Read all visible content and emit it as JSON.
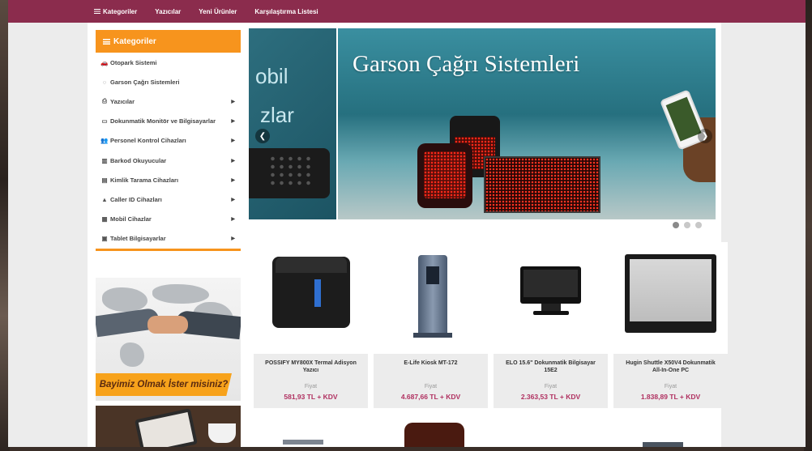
{
  "nav": {
    "items": [
      "Kategoriler",
      "Yazıcılar",
      "Yeni Ürünler",
      "Karşılaştırma Listesi"
    ]
  },
  "sidebar": {
    "title": "Kategoriler",
    "items": [
      {
        "label": "Otopark Sistemi",
        "icon": "car-icon",
        "has_arrow": false
      },
      {
        "label": "Garson Çağrı Sistemleri",
        "icon": "bell-icon",
        "has_arrow": false
      },
      {
        "label": "Yazıcılar",
        "icon": "printer-icon",
        "has_arrow": true
      },
      {
        "label": "Dokunmatik Monitör ve Bilgisayarlar",
        "icon": "monitor-icon",
        "has_arrow": true
      },
      {
        "label": "Personel Kontrol Cihazları",
        "icon": "users-icon",
        "has_arrow": true
      },
      {
        "label": "Barkod Okuyucular",
        "icon": "barcode-icon",
        "has_arrow": true
      },
      {
        "label": "Kimlik Tarama Cihazları",
        "icon": "id-card-icon",
        "has_arrow": true
      },
      {
        "label": "Caller ID Cihazları",
        "icon": "warning-icon",
        "has_arrow": true
      },
      {
        "label": "Mobil Cihazlar",
        "icon": "building-icon",
        "has_arrow": true
      },
      {
        "label": "Tablet Bilgisayarlar",
        "icon": "image-icon",
        "has_arrow": true
      }
    ]
  },
  "banner": {
    "cta": "Bayimiz Olmak İster misiniz?"
  },
  "slider": {
    "title": "Garson Çağrı Sistemleri",
    "prev_text_1": "obil",
    "prev_text_2": "zlar",
    "dots": 3,
    "active_dot": 0
  },
  "products": [
    {
      "name": "POSSIFY MY800X Termal Adisyon Yazıcı",
      "price_label": "Fiyat",
      "price": "581,93 TL + KDV"
    },
    {
      "name": "E-Life Kiosk MT-172",
      "price_label": "Fiyat",
      "price": "4.687,66 TL + KDV"
    },
    {
      "name": "ELO 15.6\" Dokunmatik Bilgisayar 15E2",
      "price_label": "Fiyat",
      "price": "2.363,53 TL + KDV"
    },
    {
      "name": "Hugin Shuttle X50V4 Dokunmatik All-In-One PC",
      "price_label": "Fiyat",
      "price": "1.838,89 TL + KDV"
    }
  ],
  "colors": {
    "nav_bg": "#8b2c4d",
    "accent": "#f7941d",
    "price": "#b03060"
  }
}
